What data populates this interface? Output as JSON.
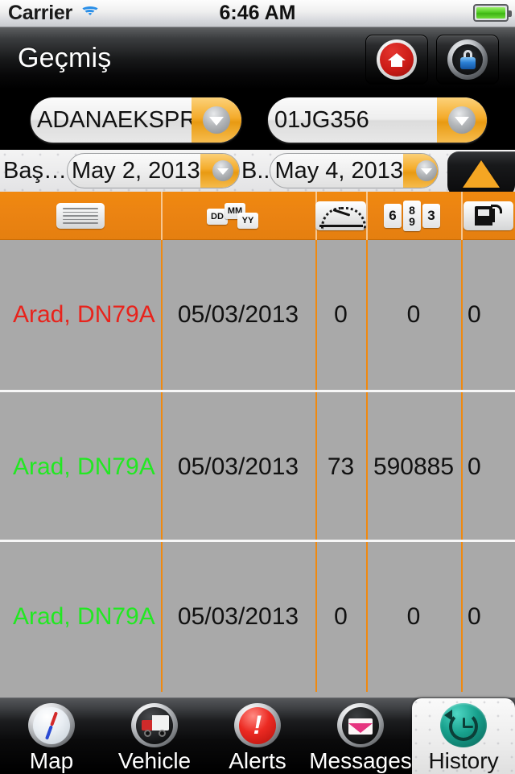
{
  "status_bar": {
    "carrier": "Carrier",
    "time": "6:46 AM",
    "wifi_icon": "wifi-icon",
    "battery_icon": "battery-full-icon"
  },
  "nav_bar": {
    "title": "Geçmiş",
    "home_button": "home-icon",
    "lock_button": "lock-icon"
  },
  "filters": {
    "vehicle_group": {
      "value": "ADANAEKSPRES",
      "arrow_icon": "chevron-down-icon"
    },
    "plate": {
      "value": "01JG356",
      "arrow_icon": "chevron-down-icon"
    },
    "start_date": {
      "label": "Baş…",
      "value": "May 2, 2013",
      "arrow_icon": "chevron-down-icon"
    },
    "end_date": {
      "label": "B..",
      "value": "May 4, 2013",
      "arrow_icon": "chevron-down-icon"
    },
    "warning_button": {
      "icon": "warning-triangle-icon",
      "color": "#f5a623"
    }
  },
  "table": {
    "header_icons": [
      "list-lines-icon",
      "date-dd-mm-yy-icon",
      "speedometer-icon",
      "odometer-counter-icon",
      "fuel-pump-icon"
    ],
    "header_color": "#ec8412",
    "row_background": "#a9a9a9",
    "rows": [
      {
        "location": "Arad, DN79A",
        "location_color": "#e8231c",
        "date": "05/03/2013",
        "speed": "0",
        "odometer": "0",
        "fuel": "0"
      },
      {
        "location": "Arad, DN79A",
        "location_color": "#22e822",
        "date": "05/03/2013",
        "speed": "73",
        "odometer": "590885",
        "fuel": "0"
      },
      {
        "location": "Arad, DN79A",
        "location_color": "#22e822",
        "date": "05/03/2013",
        "speed": "0",
        "odometer": "0",
        "fuel": "0"
      }
    ]
  },
  "tab_bar": {
    "tabs": [
      {
        "label": "Map",
        "icon": "compass-icon",
        "selected": false
      },
      {
        "label": "Vehicle",
        "icon": "truck-icon",
        "selected": false
      },
      {
        "label": "Alerts",
        "icon": "alert-icon",
        "selected": false
      },
      {
        "label": "Messages",
        "icon": "envelope-icon",
        "selected": false
      },
      {
        "label": "History",
        "icon": "clock-back-icon",
        "selected": true
      }
    ]
  }
}
